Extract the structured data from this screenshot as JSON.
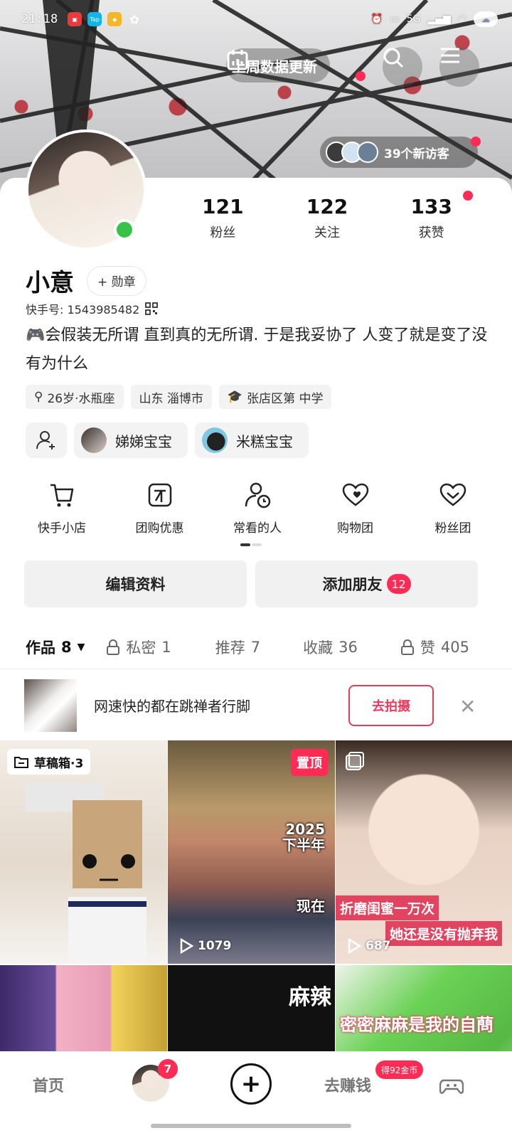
{
  "status_bar": {
    "time": "21:18",
    "network": "5G",
    "apps": [
      "app-1-icon",
      "tap-icon",
      "app-3-icon",
      "wechat-icon"
    ]
  },
  "header": {
    "weekly_update_label": "上周数据更新",
    "visitors_label": "39个新访客"
  },
  "profile": {
    "stats": [
      {
        "value": "121",
        "label": "粉丝"
      },
      {
        "value": "122",
        "label": "关注"
      },
      {
        "value": "133",
        "label": "获赞"
      }
    ],
    "name": "小意",
    "medal_label": "+ 勋章",
    "kuaishou_id": "快手号: 1543985482",
    "bio": "会假装无所谓  直到真的无所谓. 于是我妥协了 人变了就是变了没有为什么",
    "tags": [
      "26岁·水瓶座",
      "山东 淄博市",
      "张店区第  中学"
    ]
  },
  "friends": [
    {
      "name": "娣娣宝宝"
    },
    {
      "name": "米糕宝宝"
    }
  ],
  "shortcuts": [
    {
      "label": "快手小店",
      "icon": "cart-icon"
    },
    {
      "label": "团购优惠",
      "icon": "group-buy-icon"
    },
    {
      "label": "常看的人",
      "icon": "user-clock-icon"
    },
    {
      "label": "购物团",
      "icon": "heart-shopping-icon"
    },
    {
      "label": "粉丝团",
      "icon": "heart-icon"
    }
  ],
  "actions": {
    "edit_label": "编辑资料",
    "add_friend_label": "添加朋友",
    "add_friend_badge": "12"
  },
  "tabs": [
    {
      "label": "作品",
      "count": "8"
    },
    {
      "label": "私密",
      "count": "1"
    },
    {
      "label": "推荐",
      "count": "7"
    },
    {
      "label": "收藏",
      "count": "36"
    },
    {
      "label": "赞",
      "count": "405"
    }
  ],
  "tip": {
    "text": "网速快的都在跳禅者行脚",
    "button": "去拍摄"
  },
  "grid": {
    "draft_label": "草稿箱·3",
    "pinned_label": "置顶",
    "overlay_2025a": "2025",
    "overlay_2025b": "2025\n下半年",
    "overlay_now": "现在",
    "plays_2": "1079",
    "plays_3": "687",
    "caption_3a": "折磨闺蜜一万次",
    "caption_3b": "她还是没有抛弃我",
    "c6_text": "密密麻麻是我的自蔄"
  },
  "bottom_nav": {
    "home": "首页",
    "avatar_badge": "7",
    "earn": "去赚钱",
    "earn_badge": "得92金币"
  }
}
